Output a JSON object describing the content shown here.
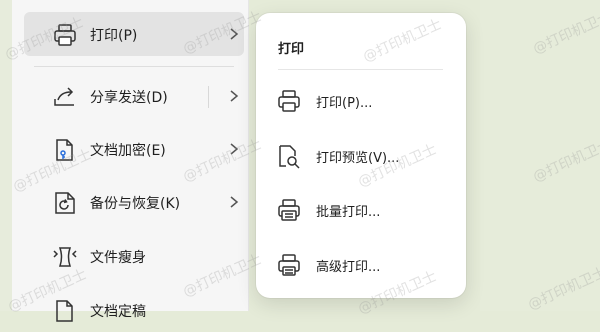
{
  "file_menu": {
    "items": [
      {
        "label": "打印(P)",
        "icon": "printer-icon"
      },
      {
        "label": "分享发送(D)",
        "icon": "share-icon"
      },
      {
        "label": "文档加密(E)",
        "icon": "document-lock-icon"
      },
      {
        "label": "备份与恢复(K)",
        "icon": "backup-icon"
      },
      {
        "label": "文件瘦身",
        "icon": "slim-file-icon"
      },
      {
        "label": "文档定稿",
        "icon": "document-icon"
      }
    ]
  },
  "print_submenu": {
    "title": "打印",
    "items": [
      {
        "label": "打印(P)...",
        "icon": "printer-icon"
      },
      {
        "label": "打印预览(V)...",
        "icon": "print-preview-icon"
      },
      {
        "label": "批量打印...",
        "icon": "batch-print-icon"
      },
      {
        "label": "高级打印...",
        "icon": "advanced-print-icon"
      }
    ]
  },
  "watermark": "@打印机卫士"
}
